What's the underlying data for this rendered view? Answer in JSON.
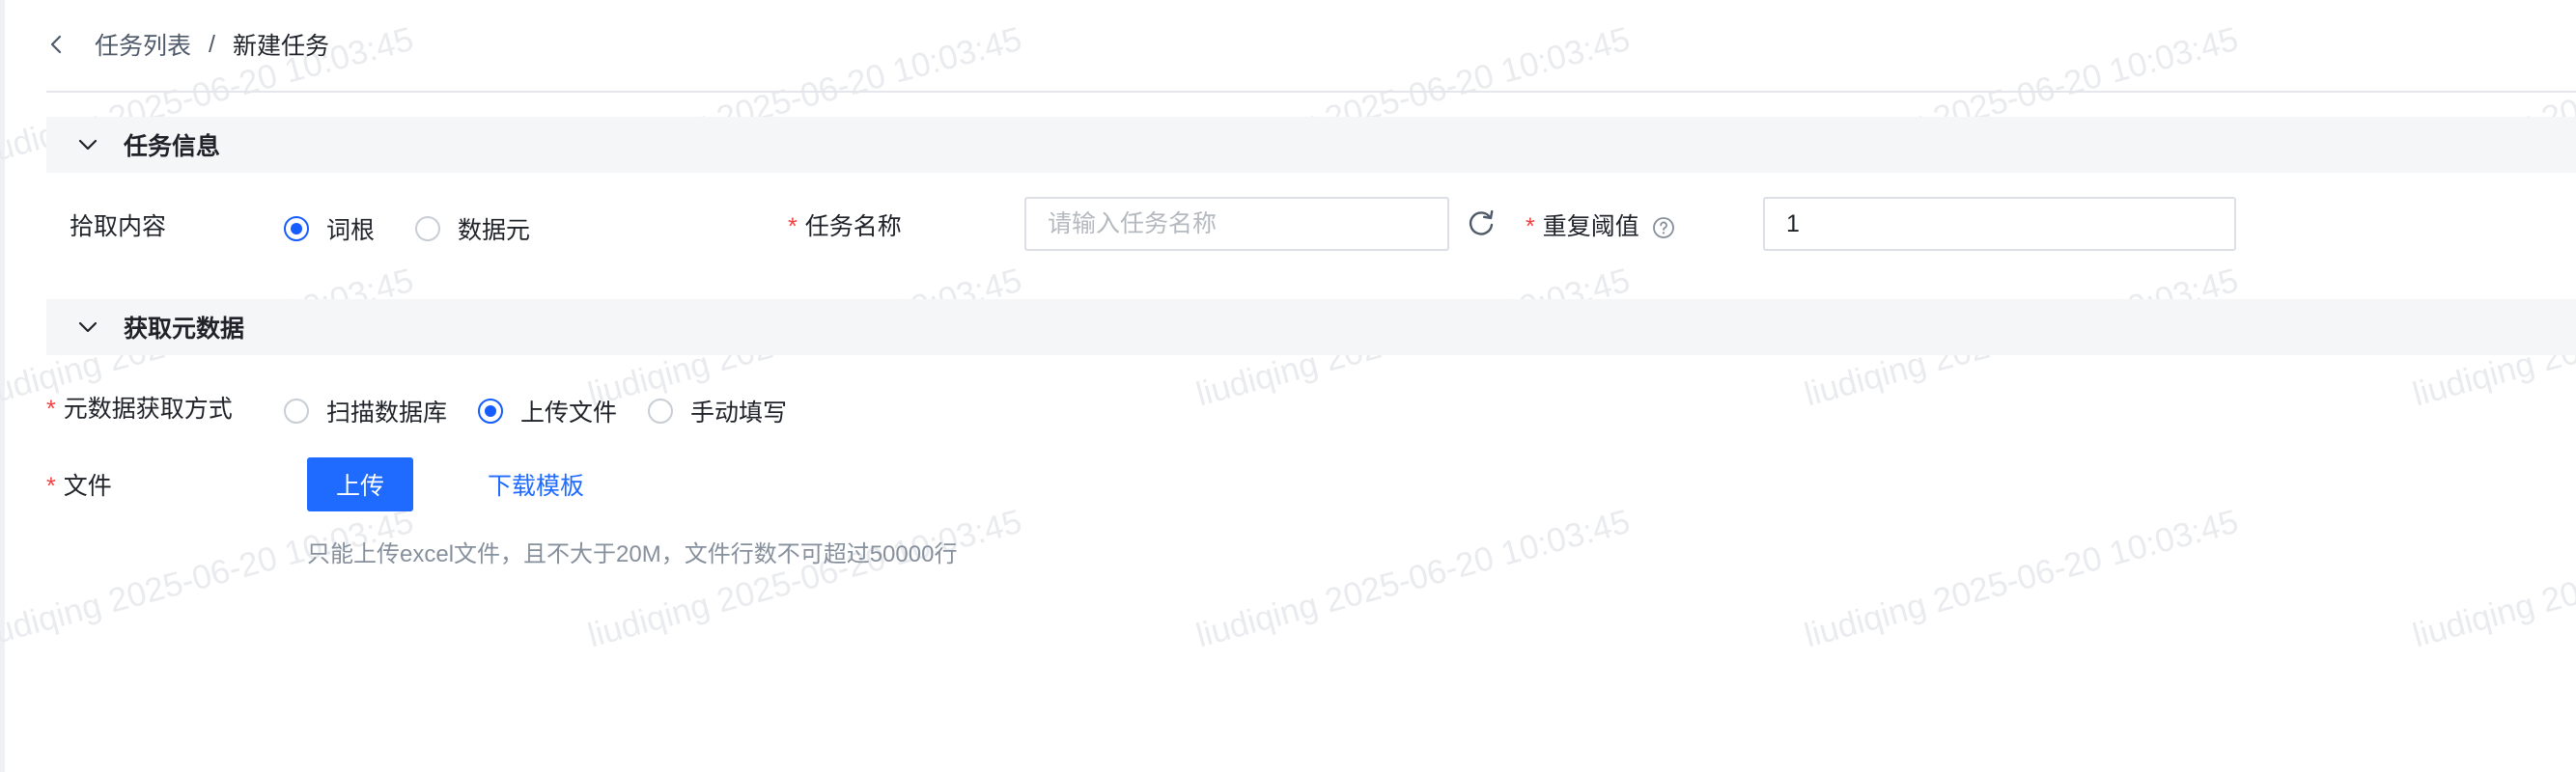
{
  "breadcrumb": {
    "parent": "任务列表",
    "separator": "/",
    "current": "新建任务"
  },
  "sections": {
    "task_info": {
      "title": "任务信息"
    },
    "metadata": {
      "title": "获取元数据"
    }
  },
  "task_info": {
    "extract_label": "拾取内容",
    "extract_options": [
      {
        "label": "词根",
        "checked": true
      },
      {
        "label": "数据元",
        "checked": false
      }
    ],
    "task_name_label": "任务名称",
    "task_name_placeholder": "请输入任务名称",
    "threshold_label": "重复阈值",
    "threshold_value": "1",
    "required_mark": "*"
  },
  "metadata": {
    "method_label": "元数据获取方式",
    "method_options": [
      {
        "label": "扫描数据库",
        "checked": false
      },
      {
        "label": "上传文件",
        "checked": true
      },
      {
        "label": "手动填写",
        "checked": false
      }
    ],
    "file_label": "文件",
    "upload_button": "上传",
    "download_template": "下载模板",
    "hint": "只能上传excel文件，且不大于20M，文件行数不可超过50000行"
  },
  "watermark": {
    "text": "liudiqing 2025-06-20 10:03:45"
  },
  "colors": {
    "primary": "#1f6bff",
    "required": "#f53f3f",
    "section_bg": "#f5f6f8"
  },
  "icons": [
    "chevron-left-icon",
    "chevron-down-icon",
    "refresh-icon",
    "question-circle-icon"
  ]
}
